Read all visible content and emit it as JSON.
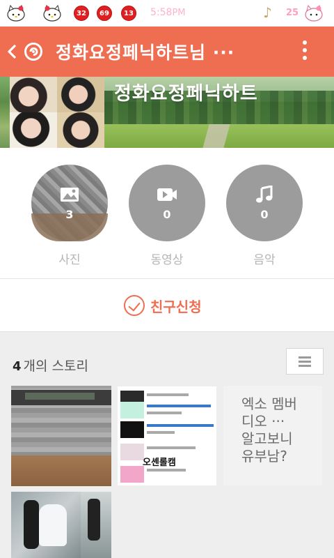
{
  "status_bar": {
    "notification_badges": [
      "32",
      "69",
      "13"
    ],
    "time": "5:58",
    "ampm": "PM",
    "battery": "25",
    "icons": [
      "hello-kitty-icon",
      "hello-kitty-icon",
      "badge-icon",
      "android-icon",
      "badge-icon",
      "music-note-icon",
      "hello-kitty-battery-icon"
    ]
  },
  "app_bar": {
    "title": "정화요정페닉하트님 ···",
    "back_icon": "chevron-left-icon",
    "logo_icon": "kakaostory-logo-icon",
    "menu_icon": "overflow-menu-icon",
    "color": "#ef6e52"
  },
  "profile": {
    "name": "정화요정페닉하트"
  },
  "stats": [
    {
      "icon": "photo-icon",
      "count": "3",
      "label": "사진"
    },
    {
      "icon": "video-icon",
      "count": "0",
      "label": "동영상"
    },
    {
      "icon": "music-icon",
      "count": "0",
      "label": "음악"
    }
  ],
  "friend_request": {
    "label": "친구신청"
  },
  "stories": {
    "count": "4",
    "count_suffix": "개의 스토리",
    "tiles": [
      {
        "kind": "photo"
      },
      {
        "kind": "screenshot",
        "overlay": "오셴롤캠"
      },
      {
        "kind": "text",
        "text": "엑소 멤버\n디오 ···\n알고보니\n유부남?"
      },
      {
        "kind": "photo"
      }
    ]
  }
}
